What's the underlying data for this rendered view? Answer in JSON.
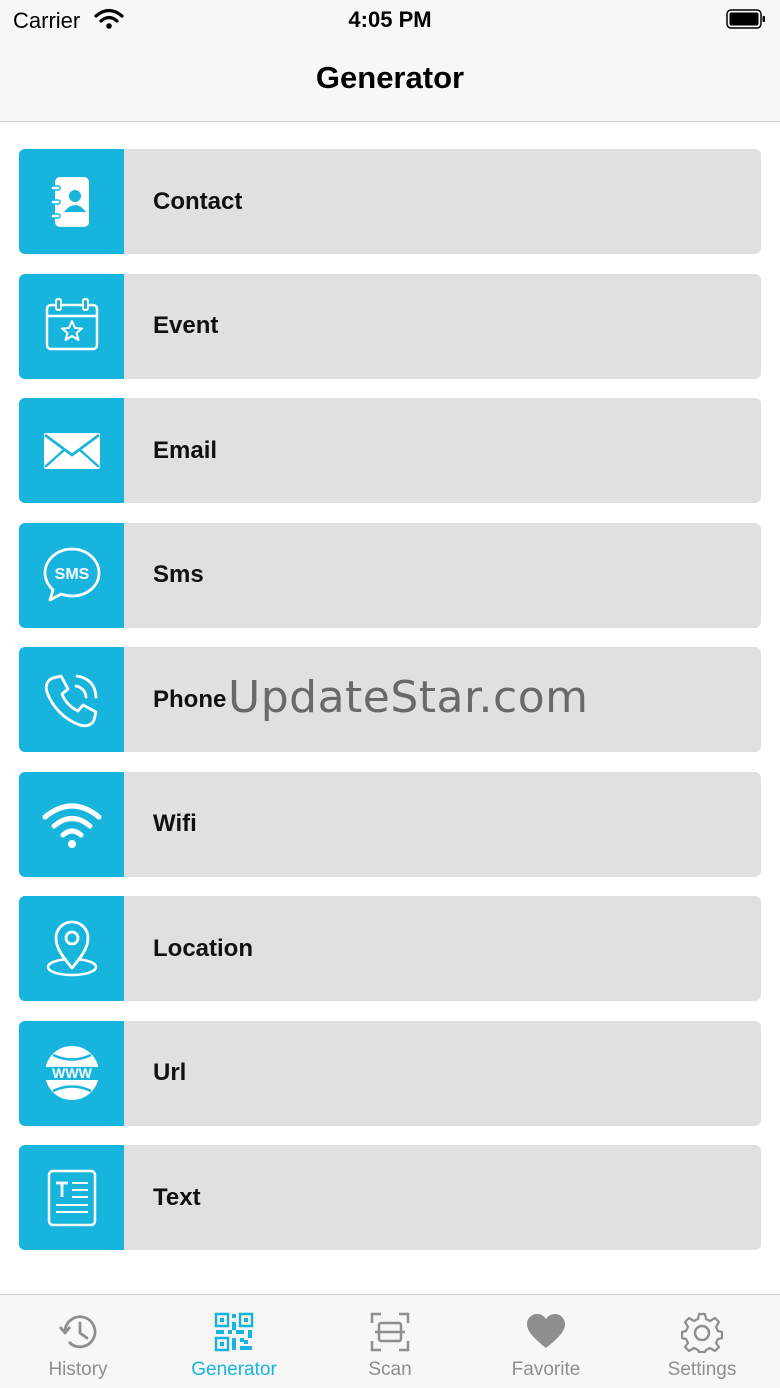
{
  "status_bar": {
    "carrier": "Carrier",
    "time": "4:05 PM"
  },
  "header": {
    "title": "Generator"
  },
  "items": [
    {
      "label": "Contact",
      "icon": "contact-book-icon"
    },
    {
      "label": "Event",
      "icon": "calendar-star-icon"
    },
    {
      "label": "Email",
      "icon": "envelope-icon"
    },
    {
      "label": "Sms",
      "icon": "sms-bubble-icon"
    },
    {
      "label": "Phone",
      "icon": "phone-icon"
    },
    {
      "label": "Wifi",
      "icon": "wifi-icon"
    },
    {
      "label": "Location",
      "icon": "location-pin-icon"
    },
    {
      "label": "Url",
      "icon": "www-globe-icon"
    },
    {
      "label": "Text",
      "icon": "text-document-icon"
    }
  ],
  "watermark": "UpdateStar.com",
  "tabs": [
    {
      "label": "History",
      "icon": "history-icon",
      "active": false
    },
    {
      "label": "Generator",
      "icon": "qr-code-icon",
      "active": true
    },
    {
      "label": "Scan",
      "icon": "scan-icon",
      "active": false
    },
    {
      "label": "Favorite",
      "icon": "heart-icon",
      "active": false
    },
    {
      "label": "Settings",
      "icon": "gear-icon",
      "active": false
    }
  ],
  "colors": {
    "accent": "#17b5dd",
    "row_background": "#e0e0e0",
    "tab_inactive": "#8e8e8e"
  }
}
